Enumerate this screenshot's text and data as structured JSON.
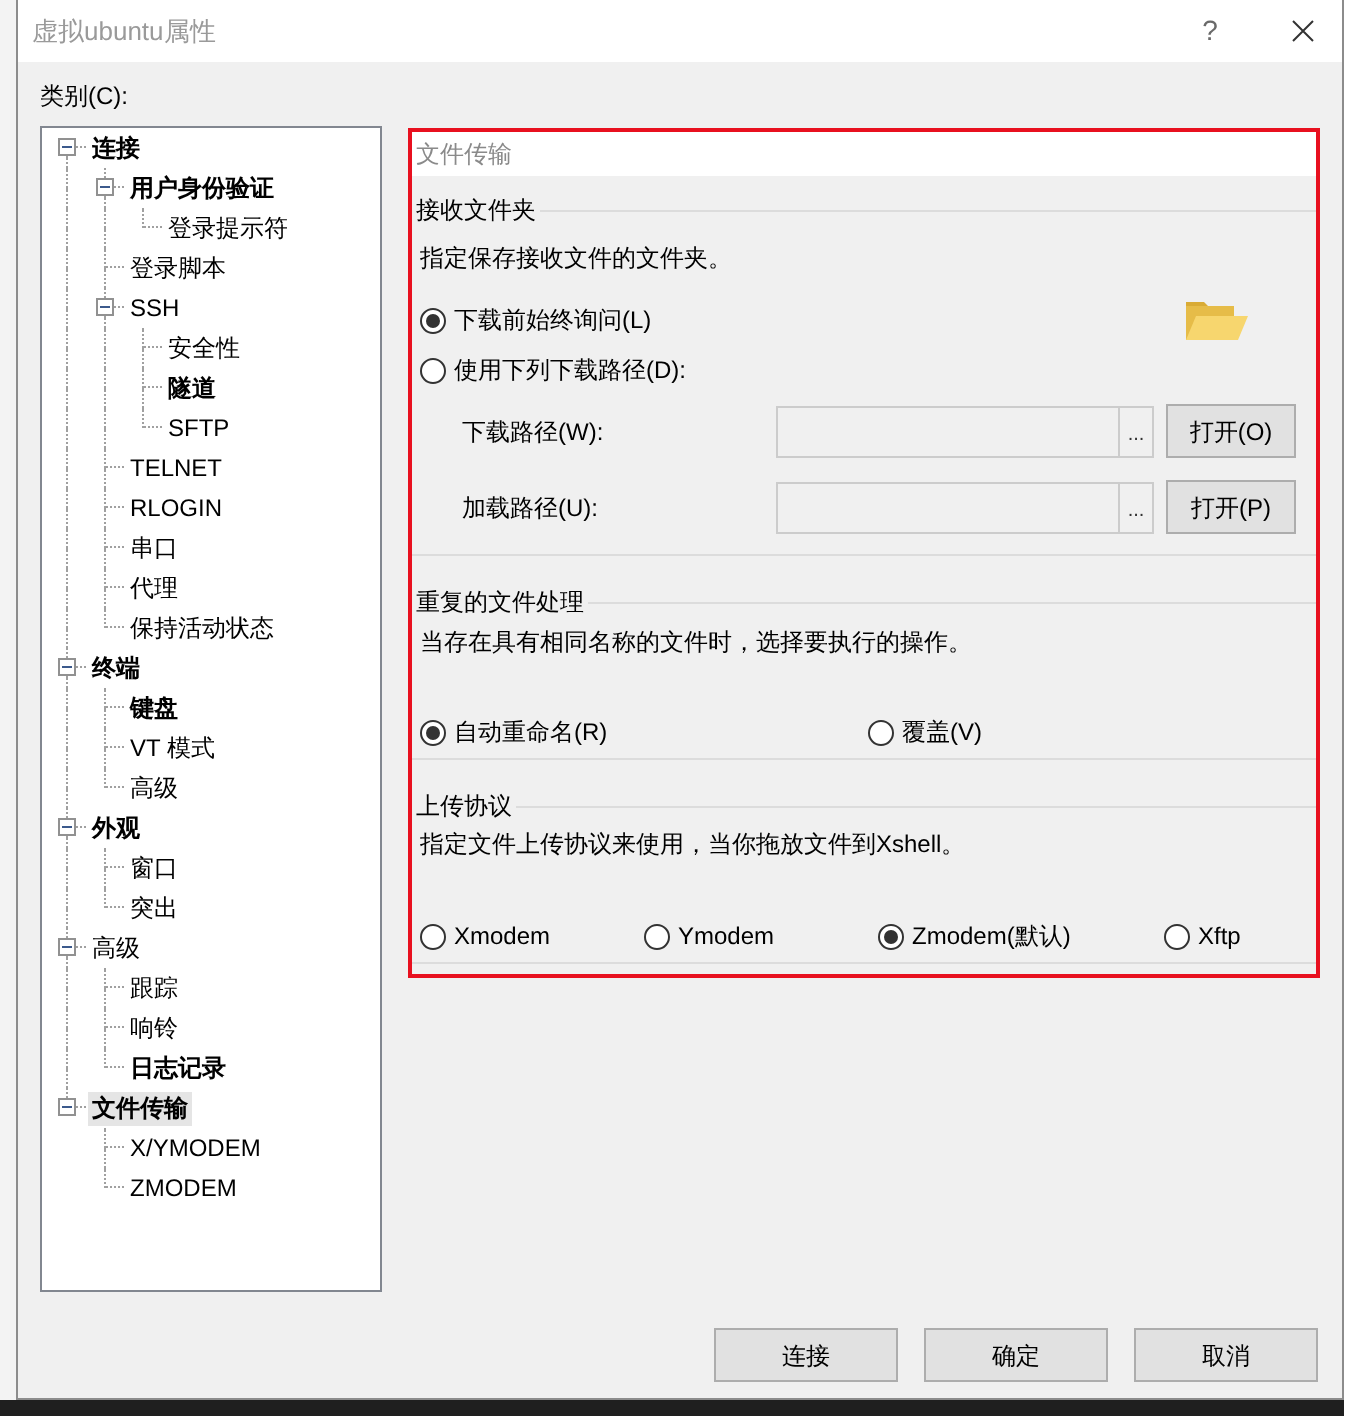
{
  "window": {
    "title": "虚拟ubuntu属性",
    "help": "?"
  },
  "category_label": "类别(C):",
  "tree": [
    {
      "label": "连接",
      "bold": true,
      "selected": false,
      "expanded": true,
      "children": [
        {
          "label": "用户身份验证",
          "bold": true,
          "selected": false,
          "expanded": true,
          "children": [
            {
              "label": "登录提示符",
              "bold": false,
              "selected": false
            }
          ]
        },
        {
          "label": "登录脚本",
          "bold": false,
          "selected": false
        },
        {
          "label": "SSH",
          "bold": false,
          "selected": false,
          "expanded": true,
          "children": [
            {
              "label": "安全性",
              "bold": false,
              "selected": false
            },
            {
              "label": "隧道",
              "bold": true,
              "selected": false
            },
            {
              "label": "SFTP",
              "bold": false,
              "selected": false
            }
          ]
        },
        {
          "label": "TELNET",
          "bold": false,
          "selected": false
        },
        {
          "label": "RLOGIN",
          "bold": false,
          "selected": false
        },
        {
          "label": "串口",
          "bold": false,
          "selected": false
        },
        {
          "label": "代理",
          "bold": false,
          "selected": false
        },
        {
          "label": "保持活动状态",
          "bold": false,
          "selected": false
        }
      ]
    },
    {
      "label": "终端",
      "bold": true,
      "selected": false,
      "expanded": true,
      "children": [
        {
          "label": "键盘",
          "bold": true,
          "selected": false
        },
        {
          "label": "VT 模式",
          "bold": false,
          "selected": false
        },
        {
          "label": "高级",
          "bold": false,
          "selected": false
        }
      ]
    },
    {
      "label": "外观",
      "bold": true,
      "selected": false,
      "expanded": true,
      "children": [
        {
          "label": "窗口",
          "bold": false,
          "selected": false
        },
        {
          "label": "突出",
          "bold": false,
          "selected": false
        }
      ]
    },
    {
      "label": "高级",
      "bold": false,
      "selected": false,
      "expanded": true,
      "children": [
        {
          "label": "跟踪",
          "bold": false,
          "selected": false
        },
        {
          "label": "响铃",
          "bold": false,
          "selected": false
        },
        {
          "label": "日志记录",
          "bold": true,
          "selected": false
        }
      ]
    },
    {
      "label": "文件传输",
      "bold": true,
      "selected": true,
      "expanded": true,
      "children": [
        {
          "label": "X/YMODEM",
          "bold": false,
          "selected": false
        },
        {
          "label": "ZMODEM",
          "bold": false,
          "selected": false
        }
      ]
    }
  ],
  "panel": {
    "title": "文件传输",
    "receive_folder": {
      "heading": "接收文件夹",
      "description": "指定保存接收文件的文件夹。",
      "options": [
        {
          "label": "下载前始终询问(L)",
          "selected": true
        },
        {
          "label": "使用下列下载路径(D):",
          "selected": false
        }
      ],
      "paths": [
        {
          "label": "下载路径(W):",
          "disabled": true,
          "browse": "...",
          "button": "打开(O)"
        },
        {
          "label": "加载路径(U):",
          "disabled": true,
          "browse": "...",
          "button": "打开(P)"
        }
      ]
    },
    "duplicate_handling": {
      "heading": "重复的文件处理",
      "description": "当存在具有相同名称的文件时，选择要执行的操作。",
      "options": [
        {
          "label": "自动重命名(R)",
          "selected": true
        },
        {
          "label": "覆盖(V)",
          "selected": false
        }
      ]
    },
    "upload_protocol": {
      "heading": "上传协议",
      "description": "指定文件上传协议来使用，当你拖放文件到Xshell。",
      "options": [
        {
          "label": "Xmodem",
          "selected": false
        },
        {
          "label": "Ymodem",
          "selected": false
        },
        {
          "label": "Zmodem(默认)",
          "selected": true
        },
        {
          "label": "Xftp",
          "selected": false
        }
      ]
    }
  },
  "buttons": [
    "连接",
    "确定",
    "取消"
  ]
}
